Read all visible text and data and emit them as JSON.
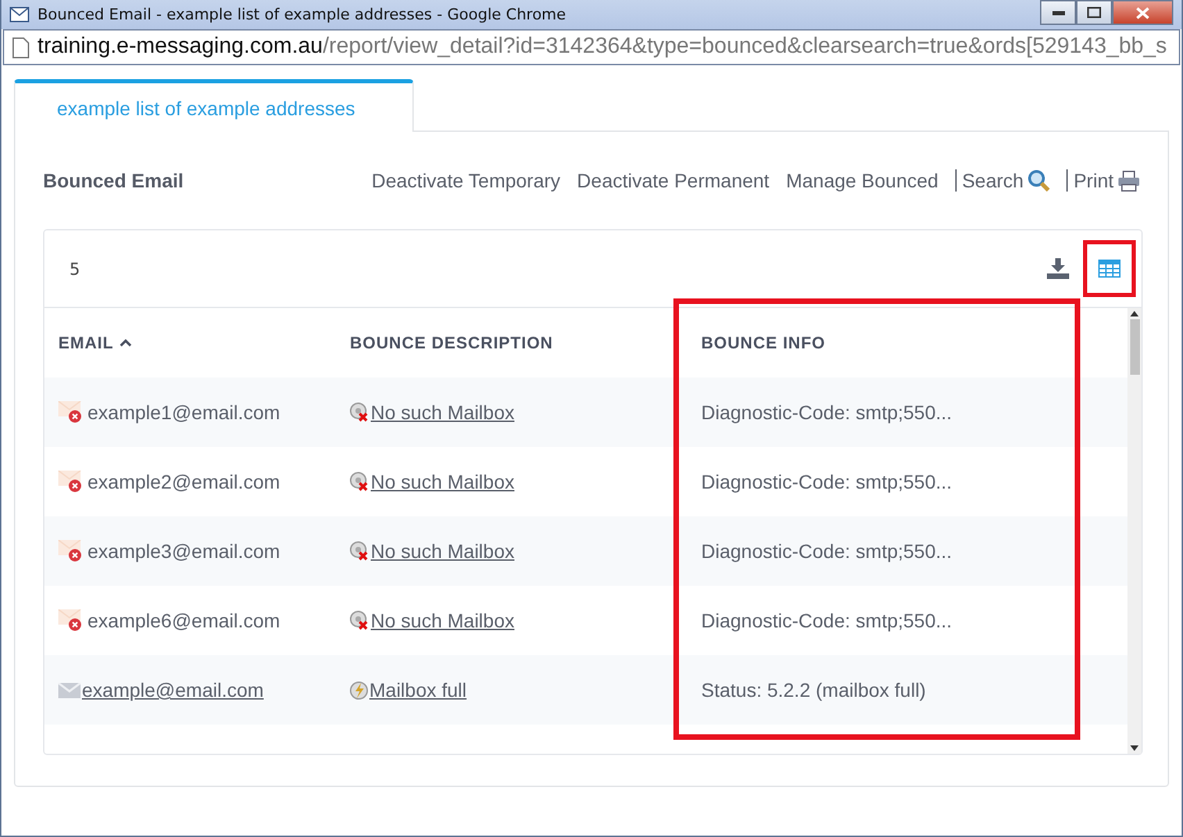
{
  "window": {
    "title": "Bounced Email - example list of example addresses - Google Chrome"
  },
  "address_bar": {
    "host": "training.e-messaging.com.au",
    "path": "/report/view_detail?id=3142364&type=bounced&clearsearch=true&ords[529143_bb_s"
  },
  "tabs": [
    {
      "label": "example list of example addresses",
      "selected": true
    }
  ],
  "toolbar": {
    "title": "Bounced Email",
    "actions": [
      {
        "label": "Deactivate Temporary",
        "kind": "link"
      },
      {
        "label": "Deactivate Permanent",
        "kind": "link"
      },
      {
        "label": "Manage Bounced",
        "kind": "link"
      },
      {
        "label": "Search",
        "kind": "search"
      },
      {
        "label": "Print",
        "kind": "print"
      }
    ]
  },
  "card": {
    "count": "5",
    "tools": [
      {
        "kind": "download",
        "highlighted": false
      },
      {
        "kind": "table",
        "highlighted": true
      }
    ]
  },
  "table": {
    "columns": [
      {
        "label": "EMAIL",
        "sorted": true,
        "highlighted": false
      },
      {
        "label": "BOUNCE DESCRIPTION",
        "sorted": false,
        "highlighted": false
      },
      {
        "label": "BOUNCE INFO",
        "sorted": false,
        "highlighted": true
      }
    ],
    "rows": [
      {
        "email": "example1@email.com",
        "kind": "blocked",
        "description": {
          "kind": "no-mailbox",
          "text": "No such Mailbox"
        },
        "info": "Diagnostic-Code: smtp;550..."
      },
      {
        "email": "example2@email.com",
        "kind": "blocked",
        "description": {
          "kind": "no-mailbox",
          "text": "No such Mailbox"
        },
        "info": "Diagnostic-Code: smtp;550..."
      },
      {
        "email": "example3@email.com",
        "kind": "blocked",
        "description": {
          "kind": "no-mailbox",
          "text": "No such Mailbox"
        },
        "info": "Diagnostic-Code: smtp;550..."
      },
      {
        "email": "example6@email.com",
        "kind": "blocked",
        "description": {
          "kind": "no-mailbox",
          "text": "No such Mailbox"
        },
        "info": "Diagnostic-Code: smtp;550..."
      },
      {
        "email": "example@email.com",
        "kind": "linked",
        "description": {
          "kind": "full",
          "text": "Mailbox full"
        },
        "info": "Status: 5.2.2 (mailbox full)"
      }
    ]
  }
}
